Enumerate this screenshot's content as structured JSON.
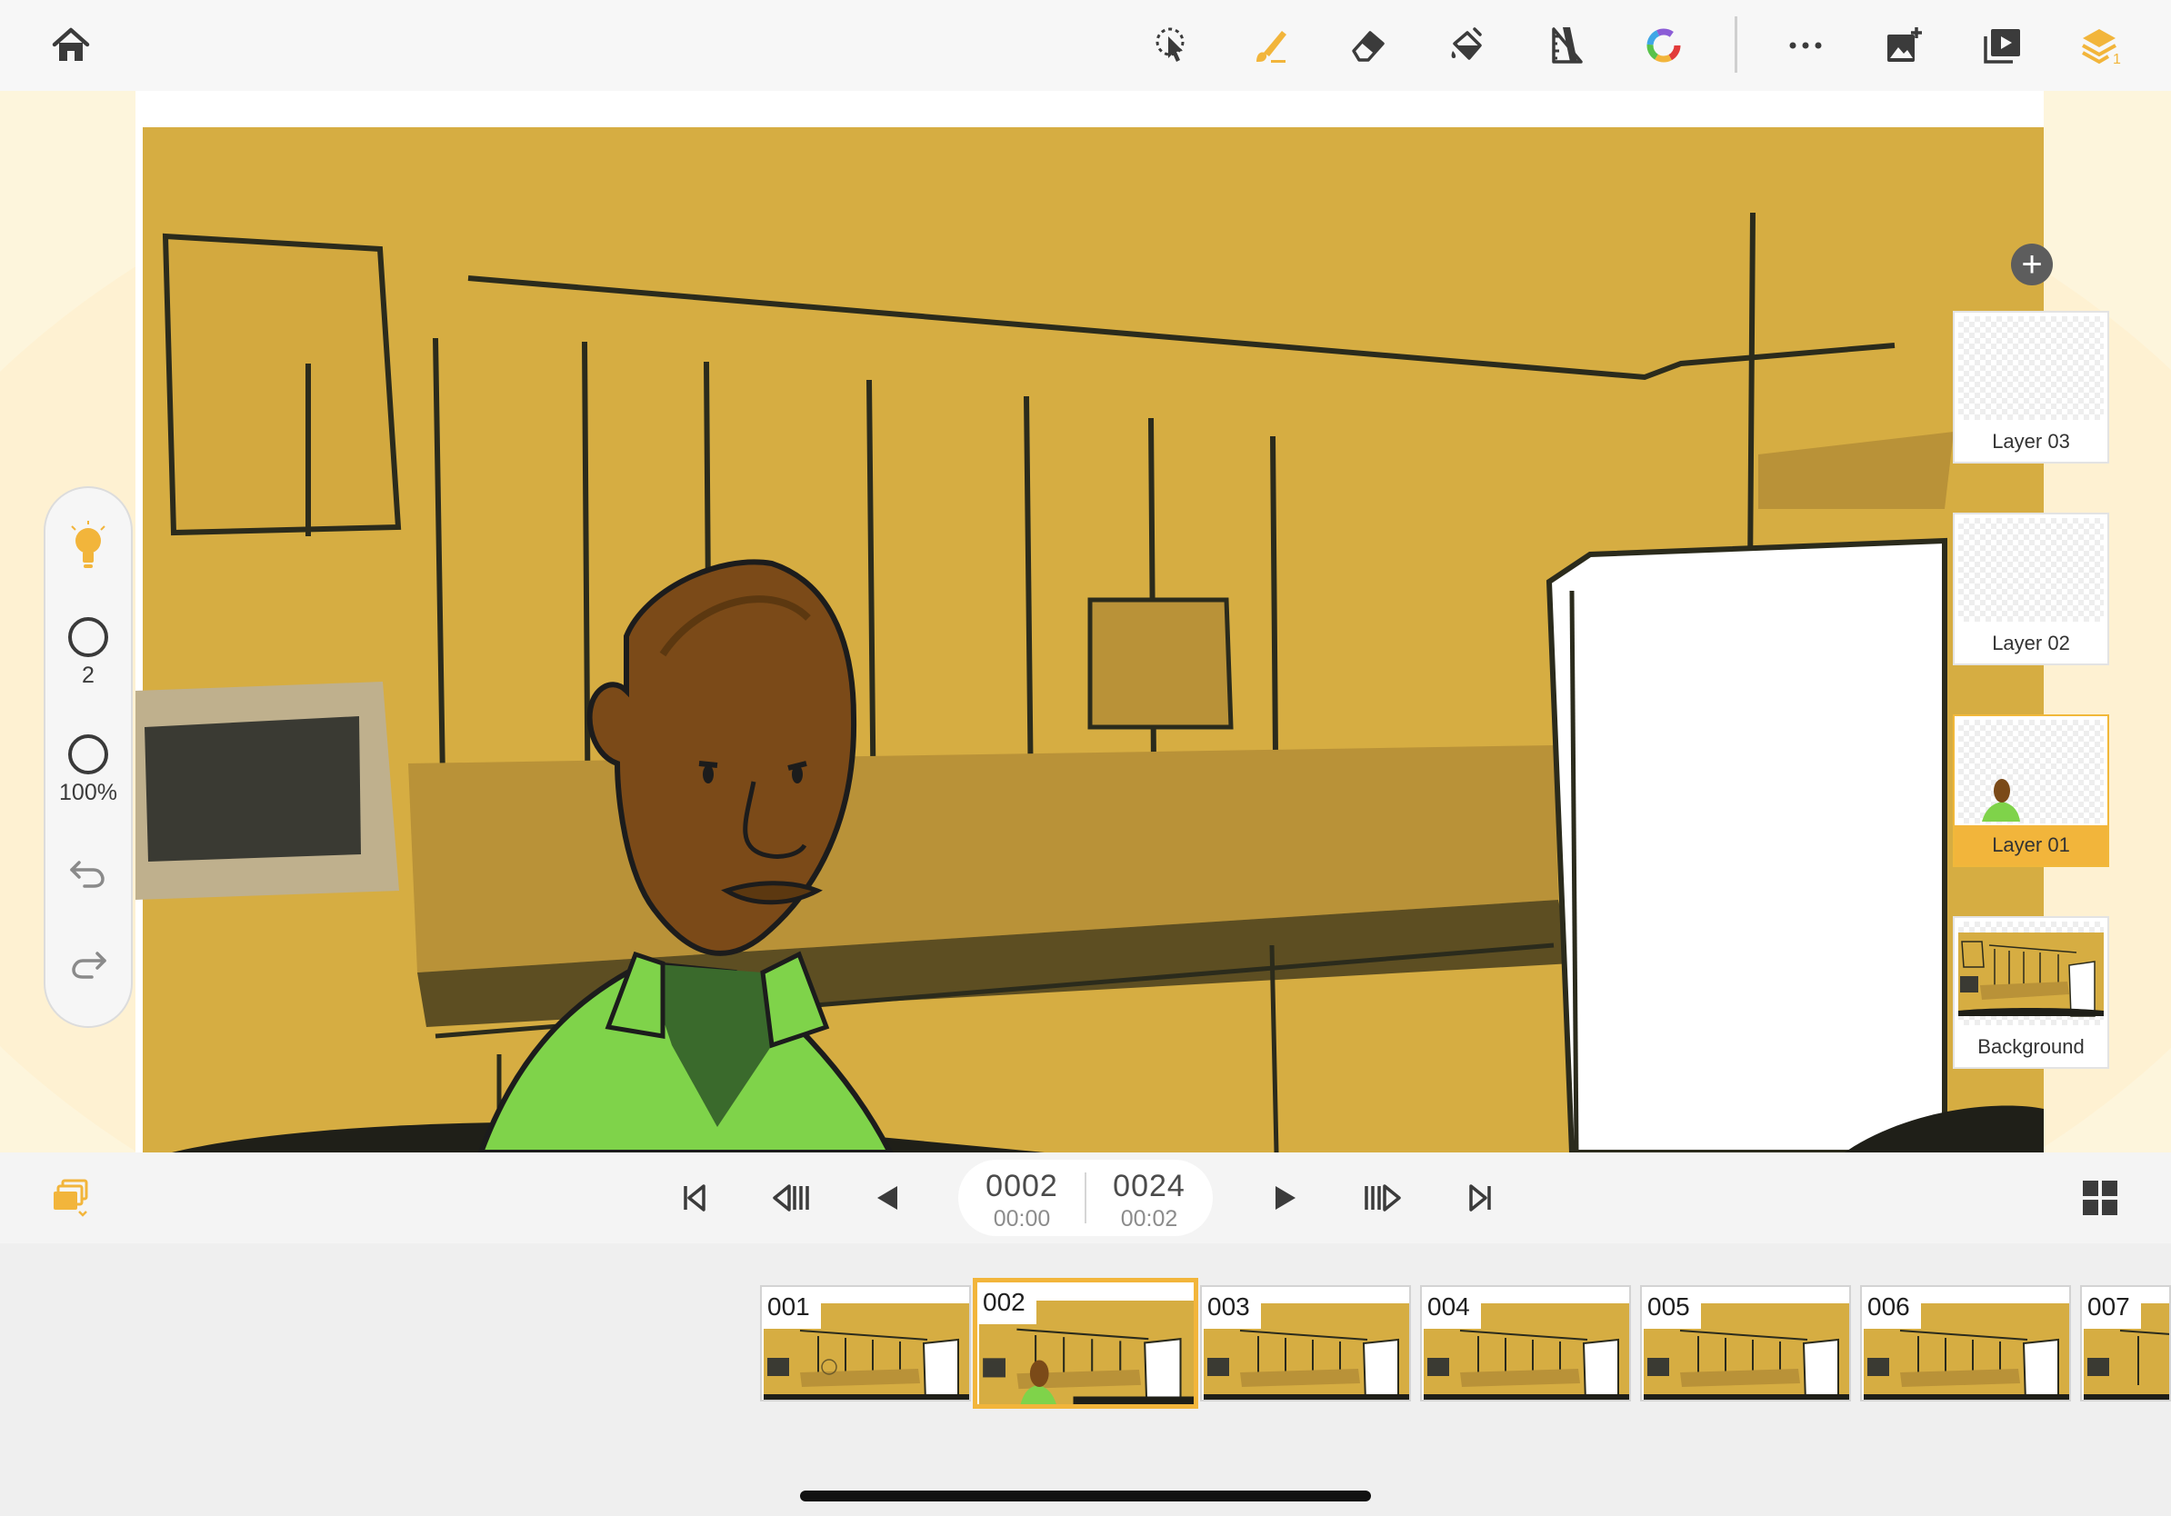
{
  "app": {
    "accent_color": "#f2b53b",
    "icon_color": "#3b3b3b"
  },
  "toolbar": {
    "left": [
      {
        "icon": "home-icon"
      }
    ],
    "tools": [
      {
        "icon": "lasso-select-icon"
      },
      {
        "icon": "brush-icon",
        "active": true
      },
      {
        "icon": "eraser-icon"
      },
      {
        "icon": "fill-bucket-icon"
      },
      {
        "icon": "ruler-icon"
      },
      {
        "icon": "color-wheel-icon"
      }
    ],
    "actions": [
      {
        "icon": "more-icon"
      },
      {
        "icon": "add-image-icon"
      },
      {
        "icon": "play-preview-icon"
      },
      {
        "icon": "layers-icon",
        "badge": "1"
      }
    ]
  },
  "rail": {
    "tips_icon": "lightbulb-icon",
    "brush_size": "2",
    "opacity": "100%",
    "undo_icon": "undo-icon",
    "redo_icon": "redo-icon"
  },
  "layers": [
    {
      "name": "Layer 03",
      "active": false,
      "thumb": "empty"
    },
    {
      "name": "Layer 02",
      "active": false,
      "thumb": "empty"
    },
    {
      "name": "Layer 01",
      "active": true,
      "thumb": "character"
    },
    {
      "name": "Background",
      "active": false,
      "thumb": "background"
    }
  ],
  "playback": {
    "current_frame": "0002",
    "current_time": "00:00",
    "total_frames": "0024",
    "total_time": "00:02",
    "buttons": [
      "first-frame-icon",
      "previous-frame-icon",
      "play-reverse-icon",
      "play-icon",
      "next-frame-icon",
      "last-frame-icon"
    ]
  },
  "timeline": {
    "frames": [
      "001",
      "002",
      "003",
      "004",
      "005",
      "006",
      "007"
    ],
    "selected": "002"
  }
}
